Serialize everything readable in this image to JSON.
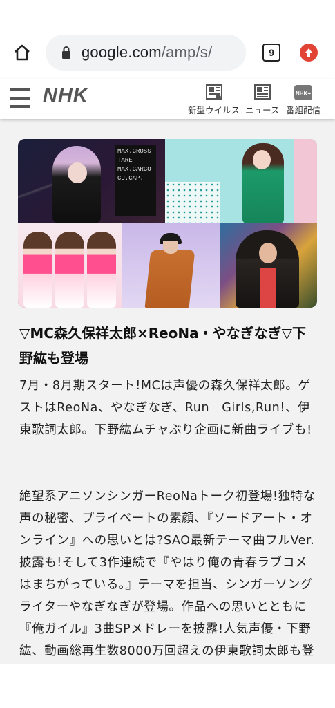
{
  "browser": {
    "url_host": "google.com",
    "url_path": "/amp/s/",
    "tab_count": "9",
    "icons": {
      "home": "home-icon",
      "lock": "lock-icon",
      "update": "update-arrow-icon"
    },
    "colors": {
      "update_badge": "#e14335",
      "omnibox": "#f1f3f4"
    }
  },
  "nhk_header": {
    "logo": "NHK",
    "nav": [
      {
        "label": "新型ウイルス",
        "icon": "virus-news-icon"
      },
      {
        "label": "ニュース",
        "icon": "newspaper-icon"
      },
      {
        "label": "番組配信",
        "icon": "nhk-plus-icon",
        "badge": "NHK+"
      }
    ]
  },
  "article": {
    "hero_tile_text": [
      "MAX.GROSS",
      "TARE",
      "MAX.CARGO",
      "CU.CAP."
    ],
    "headline": "▽MC森久保祥太郎×ReoNa・やなぎなぎ▽下野紘も登場",
    "paragraphs": [
      "7月・8月期スタート!MCは声優の森久保祥太郎。ゲストはReoNa、やなぎなぎ、Run　Girls,Run!、伊東歌詞太郎。下野紘ムチャぶり企画に新曲ライブも!",
      "絶望系アニソンシンガーReoNaトーク初登場!独特な声の秘密、プライベートの素顔、『ソードアート・オンライン』への思いとは?SAO最新テーマ曲フルVer.披露も!そして3作連続で『やはり俺の青春ラブコメはまちがっている。』テーマを担当、シンガーソングライターやなぎなぎが登場。作品への思いとともに『俺ガイル』3曲SPメドレーを披露!人気声優・下野紘、動画総再生数8000万回超えの伊東歌詞太郎も登場!"
    ],
    "colors": {
      "background": "#f2f2f2",
      "heading_link": "#3a77c6"
    }
  }
}
